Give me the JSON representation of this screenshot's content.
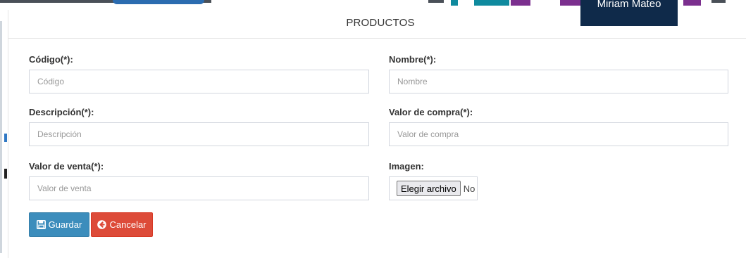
{
  "user": {
    "name": "Miriam Mateo"
  },
  "modal": {
    "title": "PRODUCTOS",
    "fields": [
      {
        "label": "Código(*):",
        "placeholder": "Código",
        "value": ""
      },
      {
        "label": "Nombre(*):",
        "placeholder": "Nombre",
        "value": ""
      },
      {
        "label": "Descripción(*):",
        "placeholder": "Descripción",
        "value": ""
      },
      {
        "label": "Valor de compra(*):",
        "placeholder": "Valor de compra",
        "value": ""
      },
      {
        "label": "Valor de venta(*):",
        "placeholder": "Valor de venta",
        "value": ""
      }
    ],
    "image": {
      "label": "Imagen:",
      "button_label": "Elegir archivo",
      "status_text": "No"
    },
    "actions": {
      "save_label": "Guardar",
      "cancel_label": "Cancelar"
    }
  },
  "colors": {
    "primary": "#3c8dbc",
    "danger": "#dd4b39",
    "user_badge": "#0f2a4a"
  },
  "icons": {
    "save": "floppy-disk-icon",
    "cancel": "circle-arrow-left-icon"
  }
}
